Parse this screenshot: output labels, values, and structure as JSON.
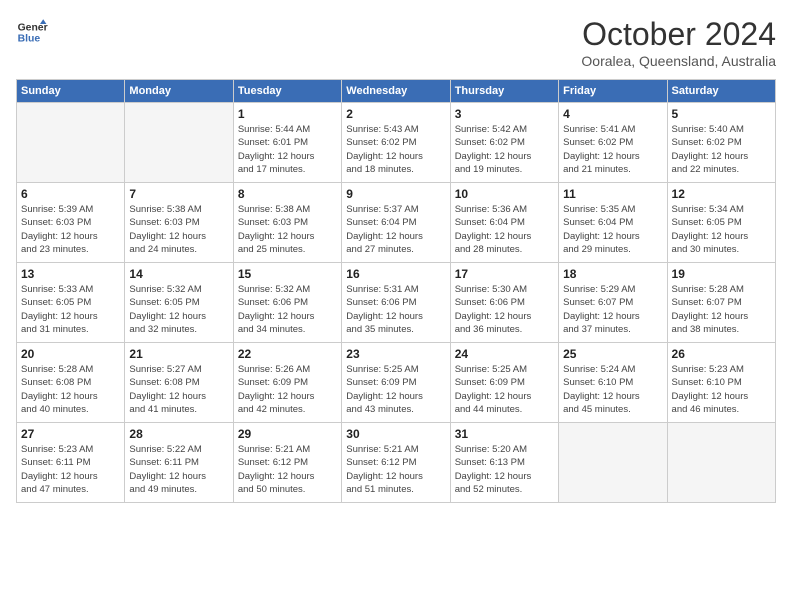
{
  "logo": {
    "line1": "General",
    "line2": "Blue"
  },
  "title": "October 2024",
  "location": "Ooralea, Queensland, Australia",
  "days_of_week": [
    "Sunday",
    "Monday",
    "Tuesday",
    "Wednesday",
    "Thursday",
    "Friday",
    "Saturday"
  ],
  "weeks": [
    [
      {
        "day": "",
        "info": ""
      },
      {
        "day": "",
        "info": ""
      },
      {
        "day": "1",
        "info": "Sunrise: 5:44 AM\nSunset: 6:01 PM\nDaylight: 12 hours\nand 17 minutes."
      },
      {
        "day": "2",
        "info": "Sunrise: 5:43 AM\nSunset: 6:02 PM\nDaylight: 12 hours\nand 18 minutes."
      },
      {
        "day": "3",
        "info": "Sunrise: 5:42 AM\nSunset: 6:02 PM\nDaylight: 12 hours\nand 19 minutes."
      },
      {
        "day": "4",
        "info": "Sunrise: 5:41 AM\nSunset: 6:02 PM\nDaylight: 12 hours\nand 21 minutes."
      },
      {
        "day": "5",
        "info": "Sunrise: 5:40 AM\nSunset: 6:02 PM\nDaylight: 12 hours\nand 22 minutes."
      }
    ],
    [
      {
        "day": "6",
        "info": "Sunrise: 5:39 AM\nSunset: 6:03 PM\nDaylight: 12 hours\nand 23 minutes."
      },
      {
        "day": "7",
        "info": "Sunrise: 5:38 AM\nSunset: 6:03 PM\nDaylight: 12 hours\nand 24 minutes."
      },
      {
        "day": "8",
        "info": "Sunrise: 5:38 AM\nSunset: 6:03 PM\nDaylight: 12 hours\nand 25 minutes."
      },
      {
        "day": "9",
        "info": "Sunrise: 5:37 AM\nSunset: 6:04 PM\nDaylight: 12 hours\nand 27 minutes."
      },
      {
        "day": "10",
        "info": "Sunrise: 5:36 AM\nSunset: 6:04 PM\nDaylight: 12 hours\nand 28 minutes."
      },
      {
        "day": "11",
        "info": "Sunrise: 5:35 AM\nSunset: 6:04 PM\nDaylight: 12 hours\nand 29 minutes."
      },
      {
        "day": "12",
        "info": "Sunrise: 5:34 AM\nSunset: 6:05 PM\nDaylight: 12 hours\nand 30 minutes."
      }
    ],
    [
      {
        "day": "13",
        "info": "Sunrise: 5:33 AM\nSunset: 6:05 PM\nDaylight: 12 hours\nand 31 minutes."
      },
      {
        "day": "14",
        "info": "Sunrise: 5:32 AM\nSunset: 6:05 PM\nDaylight: 12 hours\nand 32 minutes."
      },
      {
        "day": "15",
        "info": "Sunrise: 5:32 AM\nSunset: 6:06 PM\nDaylight: 12 hours\nand 34 minutes."
      },
      {
        "day": "16",
        "info": "Sunrise: 5:31 AM\nSunset: 6:06 PM\nDaylight: 12 hours\nand 35 minutes."
      },
      {
        "day": "17",
        "info": "Sunrise: 5:30 AM\nSunset: 6:06 PM\nDaylight: 12 hours\nand 36 minutes."
      },
      {
        "day": "18",
        "info": "Sunrise: 5:29 AM\nSunset: 6:07 PM\nDaylight: 12 hours\nand 37 minutes."
      },
      {
        "day": "19",
        "info": "Sunrise: 5:28 AM\nSunset: 6:07 PM\nDaylight: 12 hours\nand 38 minutes."
      }
    ],
    [
      {
        "day": "20",
        "info": "Sunrise: 5:28 AM\nSunset: 6:08 PM\nDaylight: 12 hours\nand 40 minutes."
      },
      {
        "day": "21",
        "info": "Sunrise: 5:27 AM\nSunset: 6:08 PM\nDaylight: 12 hours\nand 41 minutes."
      },
      {
        "day": "22",
        "info": "Sunrise: 5:26 AM\nSunset: 6:09 PM\nDaylight: 12 hours\nand 42 minutes."
      },
      {
        "day": "23",
        "info": "Sunrise: 5:25 AM\nSunset: 6:09 PM\nDaylight: 12 hours\nand 43 minutes."
      },
      {
        "day": "24",
        "info": "Sunrise: 5:25 AM\nSunset: 6:09 PM\nDaylight: 12 hours\nand 44 minutes."
      },
      {
        "day": "25",
        "info": "Sunrise: 5:24 AM\nSunset: 6:10 PM\nDaylight: 12 hours\nand 45 minutes."
      },
      {
        "day": "26",
        "info": "Sunrise: 5:23 AM\nSunset: 6:10 PM\nDaylight: 12 hours\nand 46 minutes."
      }
    ],
    [
      {
        "day": "27",
        "info": "Sunrise: 5:23 AM\nSunset: 6:11 PM\nDaylight: 12 hours\nand 47 minutes."
      },
      {
        "day": "28",
        "info": "Sunrise: 5:22 AM\nSunset: 6:11 PM\nDaylight: 12 hours\nand 49 minutes."
      },
      {
        "day": "29",
        "info": "Sunrise: 5:21 AM\nSunset: 6:12 PM\nDaylight: 12 hours\nand 50 minutes."
      },
      {
        "day": "30",
        "info": "Sunrise: 5:21 AM\nSunset: 6:12 PM\nDaylight: 12 hours\nand 51 minutes."
      },
      {
        "day": "31",
        "info": "Sunrise: 5:20 AM\nSunset: 6:13 PM\nDaylight: 12 hours\nand 52 minutes."
      },
      {
        "day": "",
        "info": ""
      },
      {
        "day": "",
        "info": ""
      }
    ]
  ]
}
